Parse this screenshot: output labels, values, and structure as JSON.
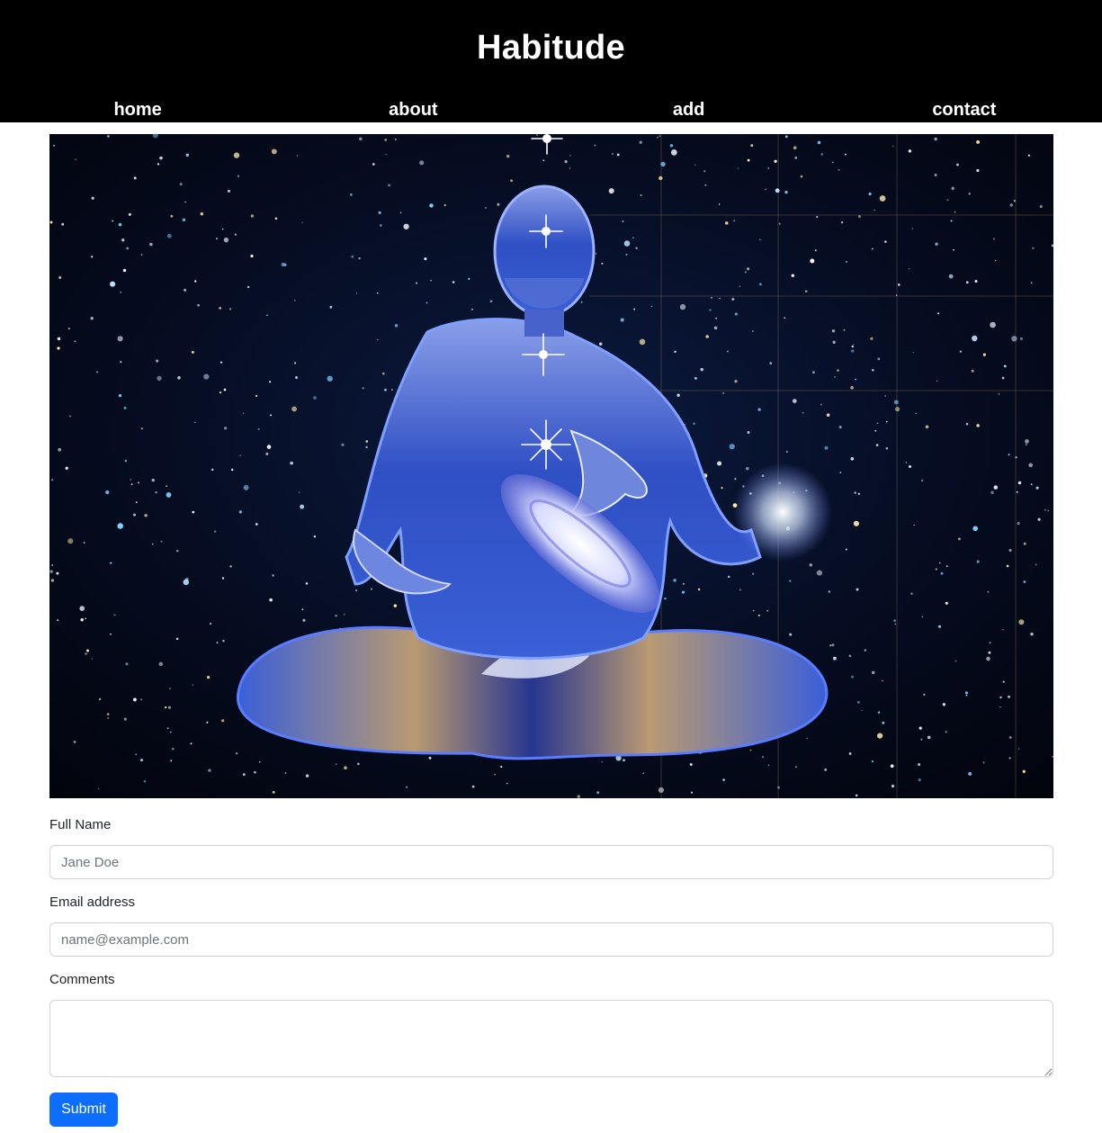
{
  "header": {
    "title": "Habitude",
    "nav": [
      {
        "label": "home"
      },
      {
        "label": "about"
      },
      {
        "label": "add"
      },
      {
        "label": "contact"
      }
    ]
  },
  "hero": {
    "subject": "meditating-figure-among-stars-icon"
  },
  "form": {
    "full_name": {
      "label": "Full Name",
      "placeholder": "Jane Doe",
      "value": ""
    },
    "email": {
      "label": "Email address",
      "placeholder": "name@example.com",
      "value": ""
    },
    "comments": {
      "label": "Comments",
      "value": ""
    },
    "submit_label": "Submit"
  },
  "colors": {
    "header_bg": "#000000",
    "header_text": "#ffffff",
    "button_primary": "#0d6efd",
    "input_border": "#ced4da"
  }
}
